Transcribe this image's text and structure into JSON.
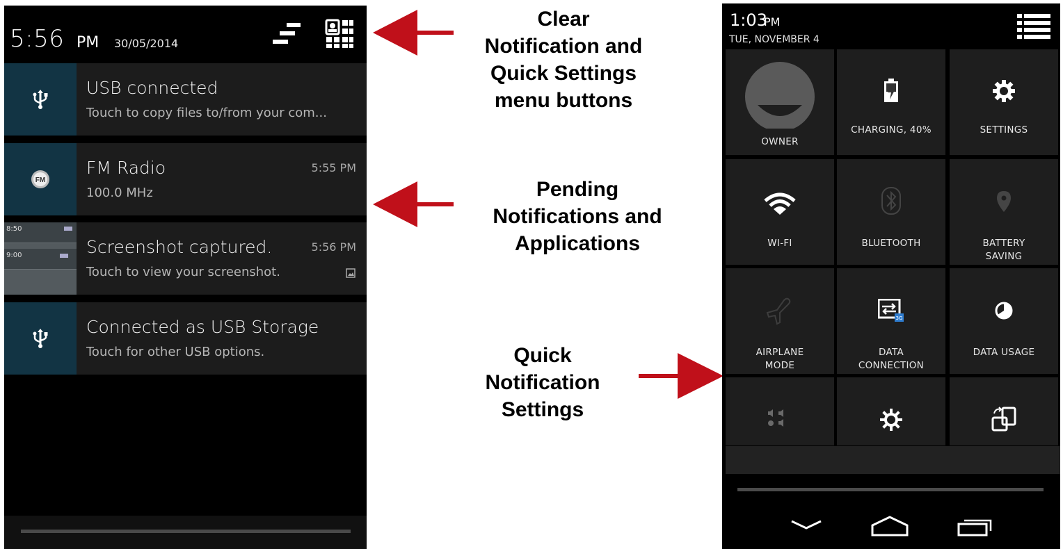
{
  "left_panel": {
    "time": "5:56",
    "ampm": "PM",
    "date": "30/05/2014",
    "notifications": [
      {
        "title": "USB connected",
        "subtitle": "Touch to copy files to/from your com...",
        "time": "",
        "icon": "usb-icon"
      },
      {
        "title": "FM Radio",
        "subtitle": "100.0 MHz",
        "time": "5:55 PM",
        "icon": "fm-radio-icon"
      },
      {
        "title": "Screenshot captured.",
        "subtitle": "Touch to view your screenshot.",
        "time": "5:56 PM",
        "icon": "screenshot-thumbnail"
      },
      {
        "title": "Connected as USB Storage",
        "subtitle": "Touch for other USB options.",
        "time": "",
        "icon": "usb-icon"
      }
    ],
    "thumb_text": [
      "8:50",
      "9:00"
    ]
  },
  "callouts": {
    "top": [
      "Clear",
      "Notification and",
      "Quick Settings",
      "menu buttons"
    ],
    "middle": [
      "Pending",
      "Notifications and",
      "Applications"
    ],
    "bottom": [
      "Quick",
      "Notification",
      "Settings"
    ]
  },
  "right_panel": {
    "time": "1:03",
    "ampm": "PM",
    "date": "TUE, NOVEMBER 4",
    "tiles": [
      {
        "label": "OWNER",
        "icon": "owner-avatar-icon"
      },
      {
        "label": "CHARGING, 40%",
        "icon": "battery-charging-icon"
      },
      {
        "label": "SETTINGS",
        "icon": "settings-gear-icon"
      },
      {
        "label": "WI-FI",
        "icon": "wifi-icon"
      },
      {
        "label": "BLUETOOTH",
        "icon": "bluetooth-icon"
      },
      {
        "label_lines": [
          "BATTERY",
          "SAVING"
        ],
        "icon": "location-pin-icon"
      },
      {
        "label_lines": [
          "AIRPLANE",
          "MODE"
        ],
        "icon": "airplane-icon"
      },
      {
        "label_lines": [
          "DATA",
          "CONNECTION"
        ],
        "icon": "data-connection-icon"
      },
      {
        "label": "DATA USAGE",
        "icon": "data-usage-icon"
      },
      {
        "label": "",
        "icon": "sound-profile-icon"
      },
      {
        "label": "",
        "icon": "brightness-icon"
      },
      {
        "label": "",
        "icon": "auto-rotate-icon"
      }
    ]
  },
  "colors": {
    "arrow_red": "#c0101a",
    "icon_tile_bg": "#123444",
    "card_bg": "#1c1c1c",
    "qs_tile_bg": "#1e1e1e"
  }
}
